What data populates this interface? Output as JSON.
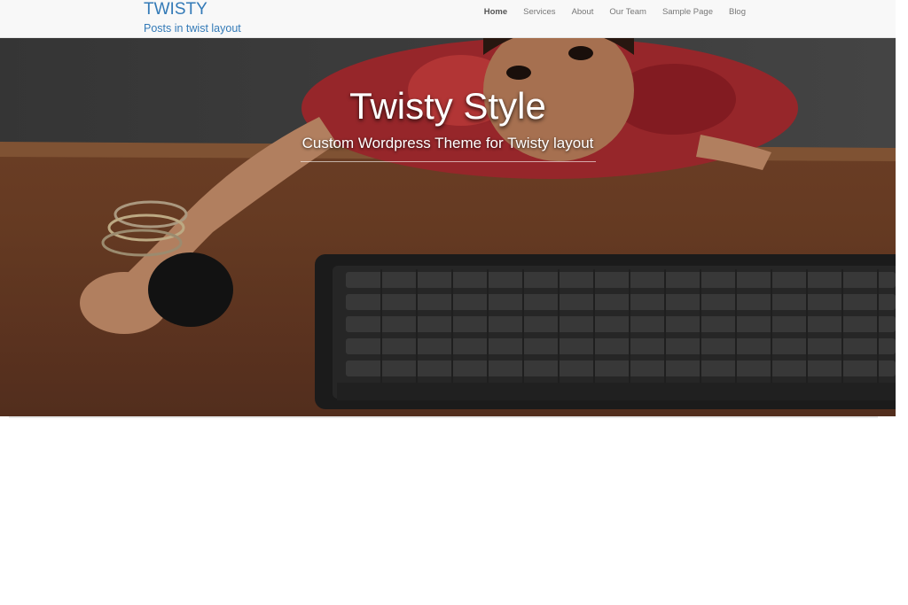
{
  "header": {
    "brand": "TWISTY",
    "tagline": "Posts in twist layout"
  },
  "nav": {
    "items": [
      {
        "label": "Home",
        "active": true
      },
      {
        "label": "Services"
      },
      {
        "label": "About"
      },
      {
        "label": "Our Team"
      },
      {
        "label": "Sample Page"
      },
      {
        "label": "Blog"
      }
    ]
  },
  "hero": {
    "title": "Twisty Style",
    "subtitle": "Custom Wordpress Theme for Twisty layout"
  },
  "colors": {
    "link": "#337ab7",
    "navbar_bg": "#f8f8f8",
    "desk": "#6f4228"
  }
}
